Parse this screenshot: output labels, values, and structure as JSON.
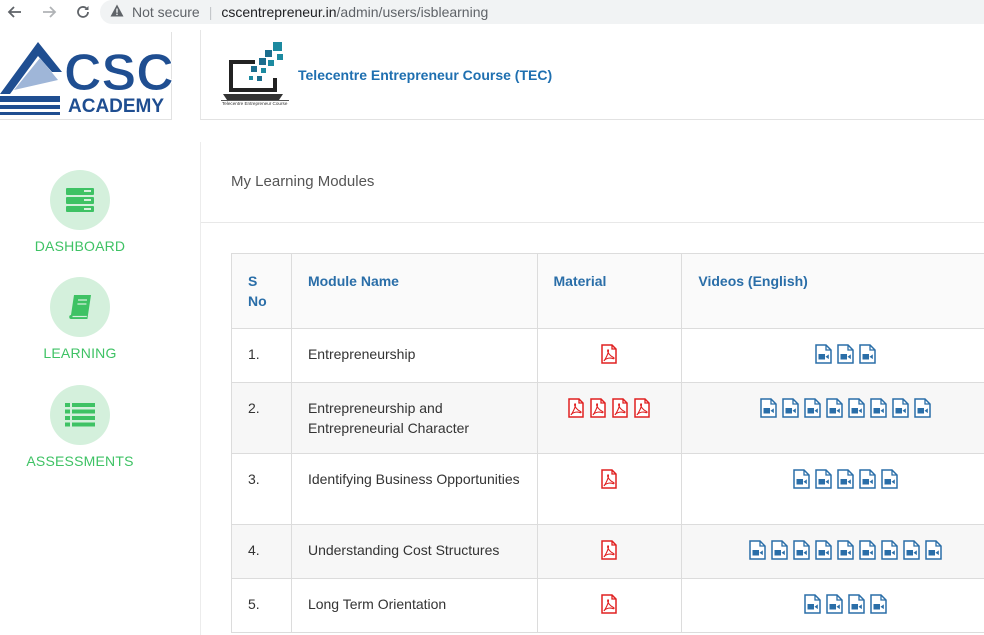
{
  "browser": {
    "security_label": "Not secure",
    "url_host": "cscentrepreneur.in",
    "url_path": "/admin/users/isblearning"
  },
  "brand": {
    "logo_text_main": "CSC",
    "logo_text_sub": "ACADEMY",
    "course_title": "Telecentre Entrepreneur Course (TEC)",
    "course_logo_caption": "Telecentre Entrepreneur Course",
    "colors": {
      "logo_blue": "#1f4e91",
      "accent_green": "#3ec264",
      "header_blue": "#1e6fb0",
      "pdf_red": "#e02020",
      "video_blue": "#2a6ea8"
    }
  },
  "sidebar": {
    "items": [
      {
        "label": "DASHBOARD",
        "icon": "dashboard-icon"
      },
      {
        "label": "LEARNING",
        "icon": "book-icon"
      },
      {
        "label": "ASSESSMENTS",
        "icon": "list-icon"
      }
    ]
  },
  "main": {
    "section_title": "My Learning Modules",
    "table": {
      "headers": {
        "sno_line1": "S",
        "sno_line2": "No",
        "name": "Module Name",
        "material": "Material",
        "videos": "Videos (English)"
      },
      "rows": [
        {
          "sno": "1.",
          "name": "Entrepreneurship",
          "pdf_count": 1,
          "video_count": 3
        },
        {
          "sno": "2.",
          "name": "Entrepreneurship and Entrepreneurial Character",
          "pdf_count": 4,
          "video_count": 8
        },
        {
          "sno": "3.",
          "name": "Identifying Business Opportunities",
          "pdf_count": 1,
          "video_count": 5
        },
        {
          "sno": "4.",
          "name": "Understanding Cost Structures",
          "pdf_count": 1,
          "video_count": 9
        },
        {
          "sno": "5.",
          "name": "Long Term Orientation",
          "pdf_count": 1,
          "video_count": 4
        }
      ]
    }
  }
}
